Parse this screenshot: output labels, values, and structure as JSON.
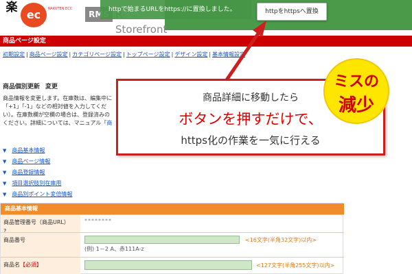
{
  "header": {
    "logo_raku": "楽",
    "logo_ec": "ec",
    "logo_small_text": "RAKUTEN ECC",
    "logo_rms": "RMS",
    "logo_rcontrol": "R-Storefront",
    "notice": "httpで始まるURLをhttps://に置換しました。",
    "replace_button": "httpをhttpsへ置換"
  },
  "page": {
    "title": "商品ページ設定",
    "nav": [
      "初期設定",
      "商品ページ設定",
      "カテゴリページ設定",
      "トップページ設定",
      "デザイン設定",
      "基本情報設定"
    ],
    "section_title": "商品個別更新",
    "section_sub": "変更",
    "desc": [
      "商品情報を変更します。在庫数は、編集中に",
      "「+1」「-1」などの相対値を入力してくだ",
      "い）。在庫数欄が空欄の場合は、登録済みの",
      "ください。詳細については、マニュアル「"
    ],
    "desc_link": "商",
    "toc": [
      "商品基本情報",
      "商品ページ情報",
      "商品登録情報",
      "項目選択肢別在庫用",
      "商品別ポイント変倍情報"
    ]
  },
  "form": {
    "head": "商品基本情報",
    "rows": {
      "manage_label": "商品管理番号（商品URL）",
      "manage_help": "?",
      "manage_value": "********",
      "number_label": "商品番号",
      "number_hint": "<16文字(半角32文字)以内>",
      "number_example": "(例) 1－2 A、赤111A-z",
      "name_label": "商品名",
      "name_required": "【必須】",
      "name_hint": "<127文字(半角255文字)以内>"
    }
  },
  "callout": {
    "line1": "商品詳細に移動したら",
    "line2": "ボタンを押すだけで、",
    "line3": "https化の作業を一気に行える"
  },
  "badge": {
    "line1": "ミスの",
    "line2": "減少"
  },
  "colors": {
    "header_green": "#4a9a4a",
    "page_title_red": "#cc0000",
    "form_head_orange": "#f08c2a",
    "callout_border": "#cc1f1f",
    "badge_yellow": "#ffe600",
    "emphasis_red": "#e00000"
  }
}
